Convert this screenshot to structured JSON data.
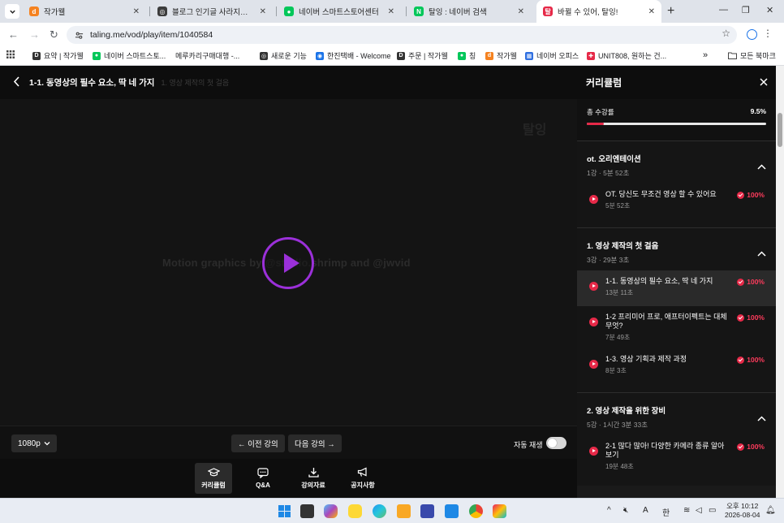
{
  "browser": {
    "tabs": [
      {
        "title": "작가웰",
        "color": "#f58220",
        "glyph": "d",
        "active": false
      },
      {
        "title": "블로그 인기글 사라지는 이유",
        "color": "#3c3c3c",
        "glyph": "◎",
        "active": false
      },
      {
        "title": "네이버 스마트스토어센터",
        "color": "#03c75a",
        "glyph": "●",
        "active": false
      },
      {
        "title": "탈잉 : 네이버 검색",
        "color": "#03c75a",
        "glyph": "N",
        "active": false
      },
      {
        "title": "바뀔 수 있어, 탈잉!",
        "color": "#e62948",
        "glyph": "탈",
        "active": true
      }
    ],
    "new_tab": "+",
    "url": "taling.me/vod/play/item/1040584",
    "bookmarks": [
      {
        "label": "요약 | 작가웰",
        "color": "#333",
        "glyph": "D"
      },
      {
        "label": "네이버 스마트스토...",
        "color": "#03c75a",
        "glyph": "●"
      },
      {
        "label": "메루카리구매대행 -...",
        "color": "#ffffff",
        "glyph": ""
      },
      {
        "label": "새로운 기능",
        "color": "#333",
        "glyph": "◎"
      },
      {
        "label": "한진택배 - Welcome",
        "color": "#1a73e8",
        "glyph": "◉"
      },
      {
        "label": "주문 | 작가웰",
        "color": "#333",
        "glyph": "D"
      },
      {
        "label": "칭",
        "color": "#03c75a",
        "glyph": "●"
      },
      {
        "label": "작가웰",
        "color": "#f58220",
        "glyph": "d"
      },
      {
        "label": "네이버 오피스",
        "color": "#2f6fe0",
        "glyph": "▦"
      },
      {
        "label": "UNIT808, 원하는 건...",
        "color": "#e62948",
        "glyph": "✚"
      }
    ],
    "bookmarks_overflow": "»",
    "all_bookmarks": "모든 북마크"
  },
  "player": {
    "back": "<",
    "lesson_title": "1-1. 동영상의 필수 요소, 딱 네 가지",
    "section_label": "1. 영상 제작의 첫 걸음",
    "watermark": "Motion graphics by @studio.shrimp and @jwvid",
    "logo_text": "탈잉",
    "quality": "1080p",
    "prev": "← 이전 강의",
    "next": "다음 강의 →",
    "autoplay_label": "자동 재생",
    "autoplay_on": false,
    "bottom_nav": [
      {
        "label": "커리큘럼",
        "icon": "graduation-cap-icon",
        "active": true
      },
      {
        "label": "Q&A",
        "icon": "chat-bubble-icon",
        "active": false
      },
      {
        "label": "강의자료",
        "icon": "download-icon",
        "active": false
      },
      {
        "label": "공지사항",
        "icon": "megaphone-icon",
        "active": false
      }
    ]
  },
  "curriculum": {
    "title": "커리큘럼",
    "progress_label": "총 수강률",
    "progress_pct": "9.5%",
    "progress_value": 0.095,
    "chapters": [
      {
        "name": "ot. 오리엔테이션",
        "meta": "1강 · 5분 52초",
        "lessons": [
          {
            "name": "OT. 당신도 무조건 영상 할 수 있어요",
            "duration": "5분 52초",
            "pct": "100%",
            "current": false
          }
        ]
      },
      {
        "name": "1. 영상 제작의 첫 걸음",
        "meta": "3강 · 29분 3초",
        "lessons": [
          {
            "name": "1-1. 동영상의 필수 요소, 딱 네 가지",
            "duration": "13분 11초",
            "pct": "100%",
            "current": true
          },
          {
            "name": "1-2 프리미어 프로, 애프터이펙트는 대체 무엇?",
            "duration": "7분 49초",
            "pct": "100%",
            "current": false
          },
          {
            "name": "1-3. 영상 기획과 제작 과정",
            "duration": "8분 3초",
            "pct": "100%",
            "current": false
          }
        ]
      },
      {
        "name": "2. 영상 제작을 위한 장비",
        "meta": "5강 · 1시간 3분 33초",
        "lessons": [
          {
            "name": "2-1 많다 많아! 다양한 카메라 종류 알아보기",
            "duration": "19분 48초",
            "pct": "100%",
            "current": false
          }
        ]
      }
    ]
  },
  "taskbar": {
    "time": "오후 10:12",
    "date": "2026-08-04",
    "ime": "한",
    "ime_a": "A"
  }
}
